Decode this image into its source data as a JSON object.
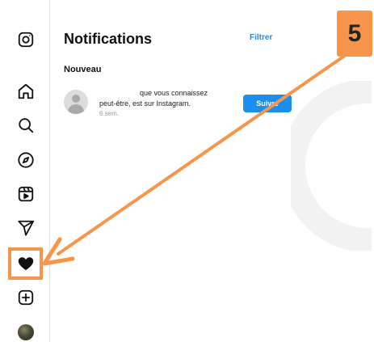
{
  "sidebar": {
    "icons": [
      "instagram-logo-icon",
      "home-icon",
      "search-icon",
      "explore-icon",
      "reels-icon",
      "messages-icon",
      "notifications-heart-icon",
      "create-icon",
      "profile-avatar"
    ]
  },
  "notifications": {
    "title": "Notifications",
    "filter_label": "Filtrer",
    "section_label": "Nouveau",
    "items": [
      {
        "text_line1": "que vous connaissez",
        "text_line2": "peut-être, est sur Instagram.",
        "time": "6 sem.",
        "button_label": "Suivre"
      }
    ]
  },
  "annotation": {
    "step_number": "5",
    "color": "#f7964a"
  },
  "colors": {
    "accent_blue": "#1a8ff0",
    "link_blue": "#2d8ad6",
    "annotation_orange": "#f7964a"
  }
}
